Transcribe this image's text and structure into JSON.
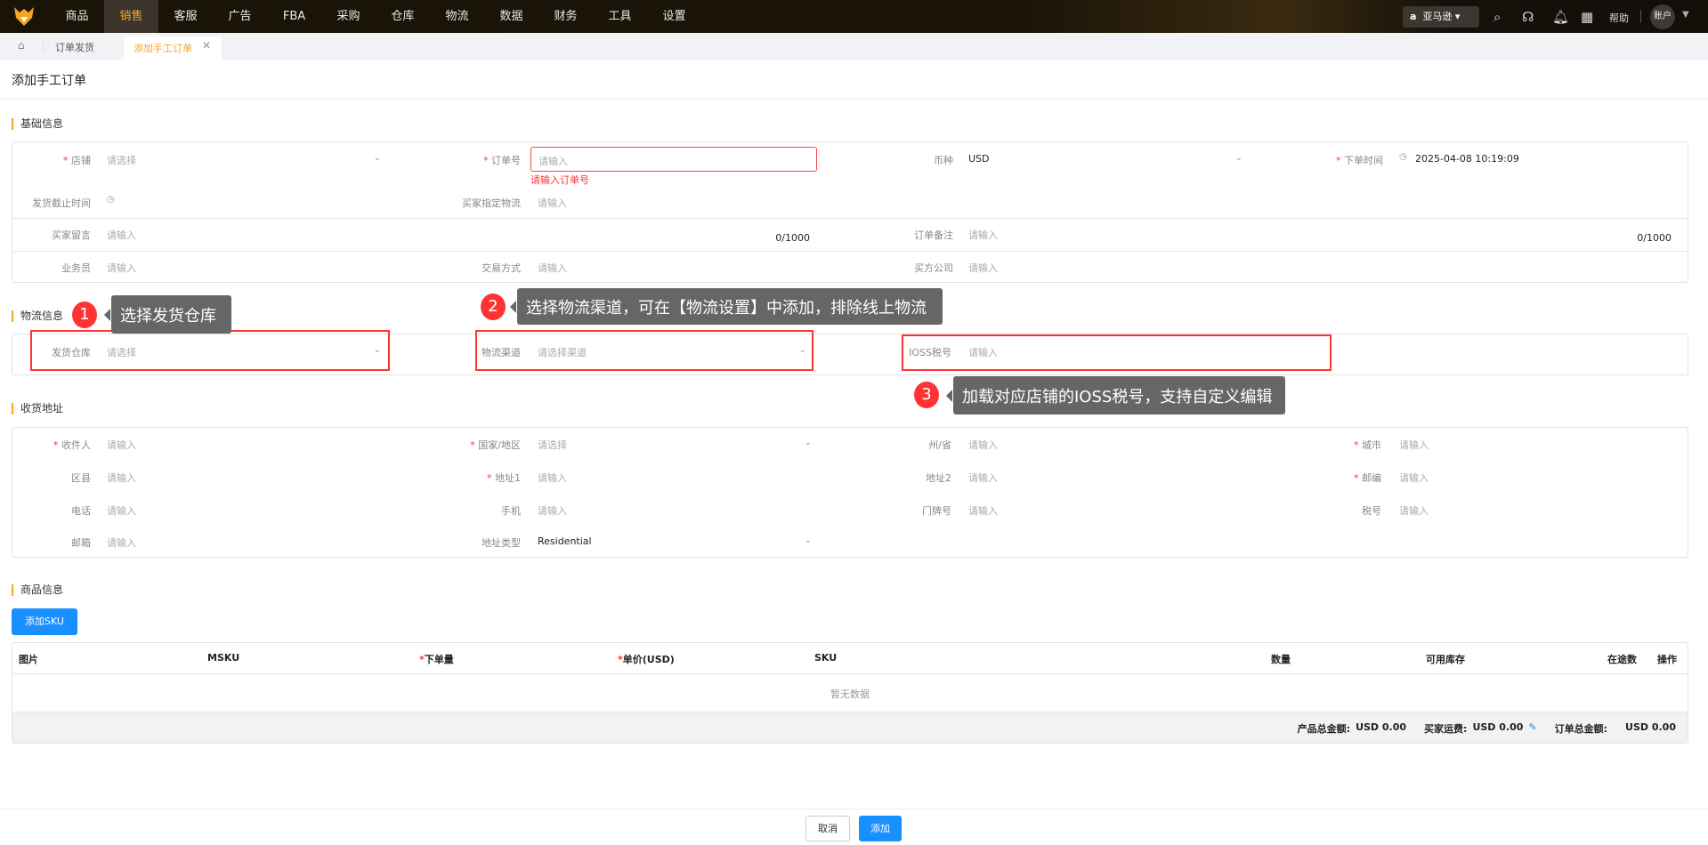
{
  "nav": {
    "items": [
      "商品",
      "销售",
      "客服",
      "广告",
      "FBA",
      "采购",
      "仓库",
      "物流",
      "数据",
      "财务",
      "工具",
      "设置"
    ],
    "active": "销售",
    "marketplace": "亚马逊",
    "help": "帮助",
    "account": "账户"
  },
  "tabs": {
    "parent": "订单发货",
    "active": "添加手工订单"
  },
  "page_title": "添加手工订单",
  "basic": {
    "title": "基础信息",
    "store": {
      "label": "店铺",
      "placeholder": "请选择"
    },
    "order_no": {
      "label": "订单号",
      "placeholder": "请输入",
      "error": "请输入订单号"
    },
    "currency": {
      "label": "币种",
      "value": "USD"
    },
    "order_time": {
      "label": "下单时间",
      "value": "2025-04-08 10:19:09"
    },
    "ship_deadline": {
      "label": "发货截止时间"
    },
    "buyer_logistics": {
      "label": "买家指定物流",
      "placeholder": "请输入"
    },
    "buyer_message": {
      "label": "买家留言",
      "placeholder": "请输入",
      "counter": "0/1000"
    },
    "order_note": {
      "label": "订单备注",
      "placeholder": "请输入",
      "counter": "0/1000"
    },
    "salesperson": {
      "label": "业务员",
      "placeholder": "请输入"
    },
    "trade_method": {
      "label": "交易方式",
      "placeholder": "请输入"
    },
    "buyer_company": {
      "label": "买方公司",
      "placeholder": "请输入"
    }
  },
  "logistics": {
    "title": "物流信息",
    "warehouse": {
      "label": "发货仓库",
      "placeholder": "请选择"
    },
    "channel": {
      "label": "物流渠道",
      "placeholder": "请选择渠道"
    },
    "ioss": {
      "label": "IOSS税号",
      "placeholder": "请输入"
    }
  },
  "callouts": [
    {
      "num": "1",
      "text": "选择发货仓库"
    },
    {
      "num": "2",
      "text": "选择物流渠道，可在【物流设置】中添加，排除线上物流"
    },
    {
      "num": "3",
      "text": "加载对应店铺的IOSS税号，支持自定义编辑"
    }
  ],
  "address": {
    "title": "收货地址",
    "rows": [
      [
        {
          "label": "收件人",
          "req": true,
          "ph": "请输入"
        },
        {
          "label": "国家/地区",
          "req": true,
          "ph": "请选择",
          "select": true
        },
        {
          "label": "州/省",
          "ph": "请输入"
        },
        {
          "label": "城市",
          "req": true,
          "ph": "请输入"
        }
      ],
      [
        {
          "label": "区县",
          "ph": "请输入"
        },
        {
          "label": "地址1",
          "req": true,
          "ph": "请输入"
        },
        {
          "label": "地址2",
          "ph": "请输入"
        },
        {
          "label": "邮编",
          "req": true,
          "ph": "请输入"
        }
      ],
      [
        {
          "label": "电话",
          "ph": "请输入"
        },
        {
          "label": "手机",
          "ph": "请输入"
        },
        {
          "label": "门牌号",
          "ph": "请输入"
        },
        {
          "label": "税号",
          "ph": "请输入"
        }
      ],
      [
        {
          "label": "邮箱",
          "ph": "请输入"
        },
        {
          "label": "地址类型",
          "value": "Residential",
          "select": true
        }
      ]
    ]
  },
  "products": {
    "title": "商品信息",
    "add_sku": "添加SKU",
    "columns": [
      "图片",
      "MSKU",
      "下单量",
      "单价(USD)",
      "SKU",
      "数量",
      "可用库存",
      "在途数",
      "操作"
    ],
    "empty": "暂无数据",
    "summary": {
      "product_total_label": "产品总金额:",
      "product_total": "USD 0.00",
      "shipping_label": "买家运费:",
      "shipping": "USD 0.00",
      "order_total_label": "订单总金额:",
      "order_total": "USD 0.00"
    }
  },
  "footer": {
    "cancel": "取消",
    "add": "添加"
  }
}
